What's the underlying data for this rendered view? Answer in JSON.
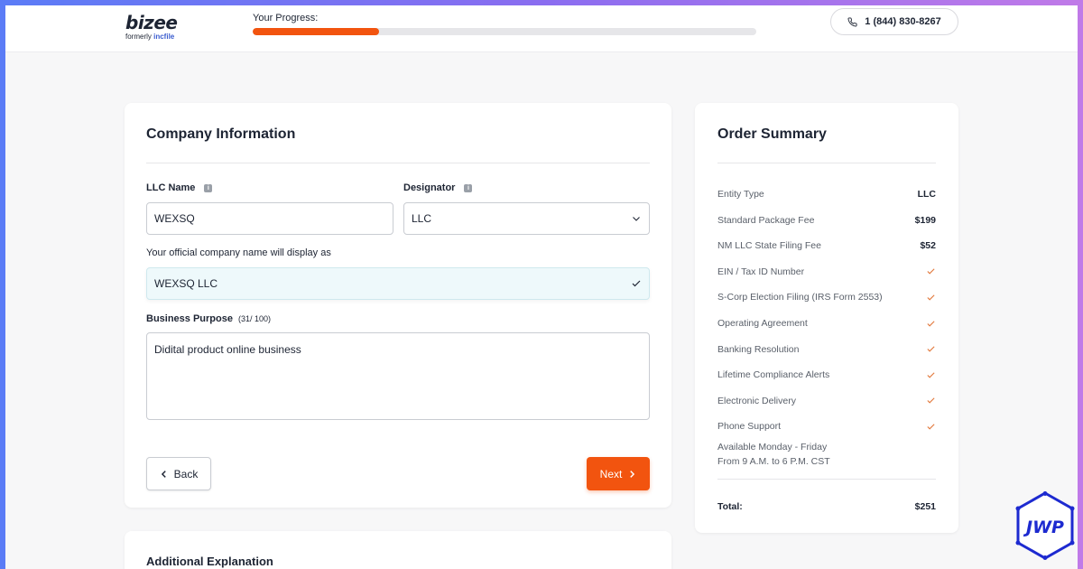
{
  "header": {
    "logo": {
      "name": "bizee",
      "subtitle_prefix": "formerly",
      "subtitle_brand": "incfile"
    },
    "progress_label": "Your Progress:",
    "progress_fraction": 0.25,
    "phone": "1 (844) 830-8267"
  },
  "company": {
    "title": "Company Information",
    "llc_name_label": "LLC Name",
    "llc_name_value": "WEXSQ",
    "designator_label": "Designator",
    "designator_value": "LLC",
    "display_hint": "Your official company name will display as",
    "display_value": "WEXSQ LLC",
    "purpose_label": "Business Purpose",
    "purpose_counter": "(31/ 100)",
    "purpose_value": "Didital product online business",
    "back_label": "Back",
    "next_label": "Next"
  },
  "extra": {
    "title": "Additional Explanation"
  },
  "summary": {
    "title": "Order Summary",
    "rows": [
      {
        "label": "Entity Type",
        "value": "LLC"
      },
      {
        "label": "Standard Package Fee",
        "value": "$199"
      },
      {
        "label": "NM LLC State Filing Fee",
        "value": "$52"
      },
      {
        "label": "EIN / Tax ID Number",
        "value": "check"
      },
      {
        "label": "S-Corp Election Filing (IRS Form 2553)",
        "value": "check"
      },
      {
        "label": "Operating Agreement",
        "value": "check"
      },
      {
        "label": "Banking Resolution",
        "value": "check"
      },
      {
        "label": "Lifetime Compliance Alerts",
        "value": "check"
      },
      {
        "label": "Electronic Delivery",
        "value": "check"
      },
      {
        "label": "Phone Support",
        "value": "check"
      }
    ],
    "availability_line1": "Available Monday - Friday",
    "availability_line2": "From 9 A.M. to 6 P.M. CST",
    "total_label": "Total:",
    "total_value": "$251"
  },
  "badge": {
    "text": "JWP"
  },
  "colors": {
    "accent": "#f2540f",
    "check": "#e2793c",
    "text": "#1d2433"
  }
}
